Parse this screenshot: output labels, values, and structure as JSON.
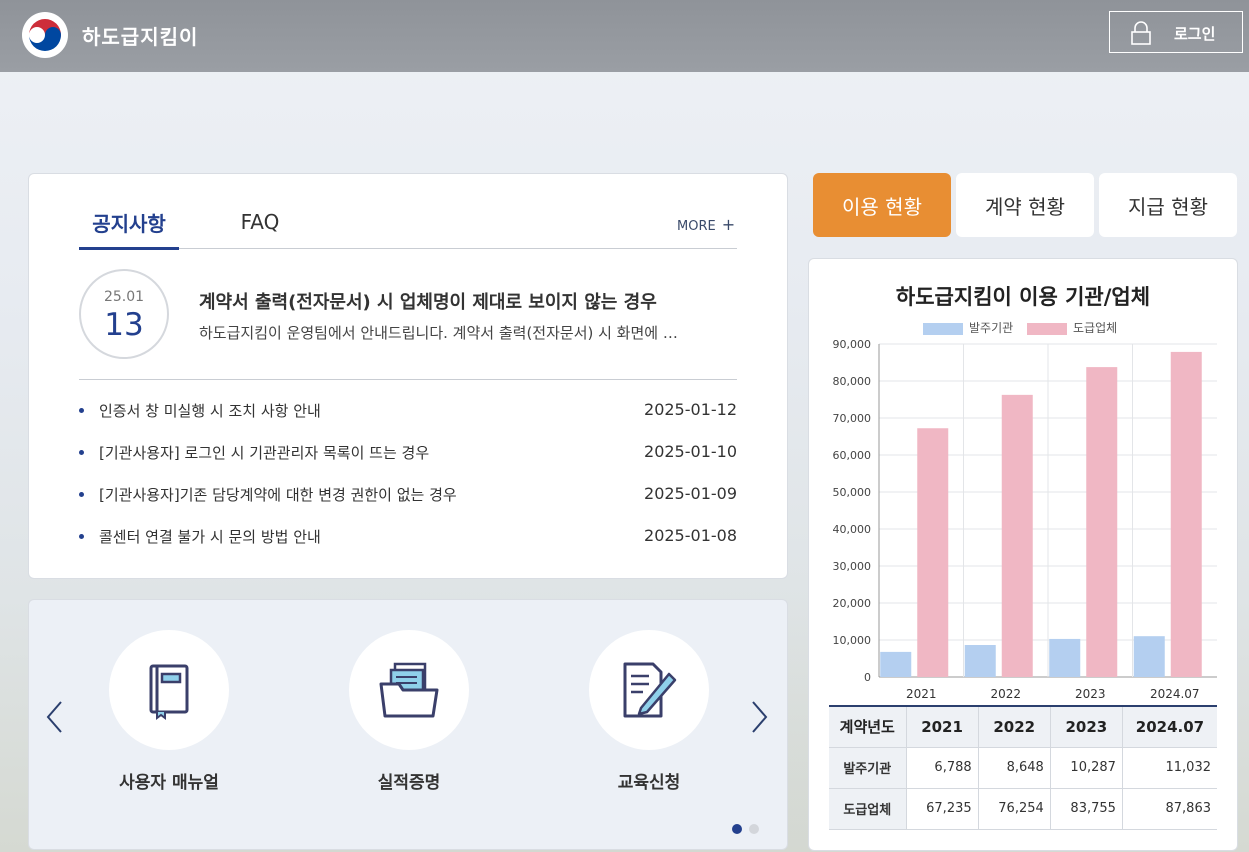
{
  "header": {
    "site_title": "하도급지킴이",
    "login_label": "로그인"
  },
  "notice": {
    "tabs": [
      "공지사항",
      "FAQ"
    ],
    "more_label": "MORE",
    "featured": {
      "date_ym": "25.01",
      "date_day": "13",
      "title": "계약서 출력(전자문서) 시 업체명이 제대로 보이지 않는 경우",
      "desc": "하도급지킴이 운영팀에서 안내드립니다. 계약서 출력(전자문서) 시 화면에 …"
    },
    "items": [
      {
        "title": "인증서 창 미실행 시 조치 사항 안내",
        "date": "2025-01-12"
      },
      {
        "title": "[기관사용자] 로그인 시 기관관리자 목록이 뜨는 경우",
        "date": "2025-01-10"
      },
      {
        "title": "[기관사용자]기존 담당계약에 대한 변경 권한이 없는 경우",
        "date": "2025-01-09"
      },
      {
        "title": "콜센터 연결 불가 시 문의 방법 안내",
        "date": "2025-01-08"
      }
    ]
  },
  "quick_menu": {
    "items": [
      {
        "label": "사용자 매뉴얼",
        "icon": "manual-book-icon"
      },
      {
        "label": "실적증명",
        "icon": "folder-documents-icon"
      },
      {
        "label": "교육신청",
        "icon": "document-pen-icon"
      }
    ],
    "active_page": 1,
    "page_count": 2
  },
  "stats_tabs": [
    "이용 현황",
    "계약 현황",
    "지급 현황"
  ],
  "stats_tabs_active": 0,
  "chart_data": {
    "type": "bar",
    "title": "하도급지킴이 이용 기관/업체",
    "categories": [
      "2021",
      "2022",
      "2023",
      "2024.07"
    ],
    "series": [
      {
        "name": "발주기관",
        "values": [
          6788,
          8648,
          10287,
          11032
        ],
        "color": "#b4cff0"
      },
      {
        "name": "도급업체",
        "values": [
          67235,
          76254,
          83755,
          87863
        ],
        "color": "#f0b7c4"
      }
    ],
    "ylim": [
      0,
      90000
    ],
    "yticks": [
      0,
      10000,
      20000,
      30000,
      40000,
      50000,
      60000,
      70000,
      80000,
      90000
    ],
    "ytick_labels": [
      "0",
      "10,000",
      "20,000",
      "30,000",
      "40,000",
      "50,000",
      "60,000",
      "70,000",
      "80,000",
      "90,000"
    ],
    "grid": true,
    "legend": "top-center"
  },
  "stats_table": {
    "header_label": "계약년도",
    "years": [
      "2021",
      "2022",
      "2023",
      "2024.07"
    ],
    "rows": [
      {
        "label": "발주기관",
        "values": [
          "6,788",
          "8,648",
          "10,287",
          "11,032"
        ]
      },
      {
        "label": "도급업체",
        "values": [
          "67,235",
          "76,254",
          "83,755",
          "87,863"
        ]
      }
    ]
  },
  "colors": {
    "primary": "#23408e",
    "accent": "#e88e33",
    "header_bg": "#979ba1"
  }
}
